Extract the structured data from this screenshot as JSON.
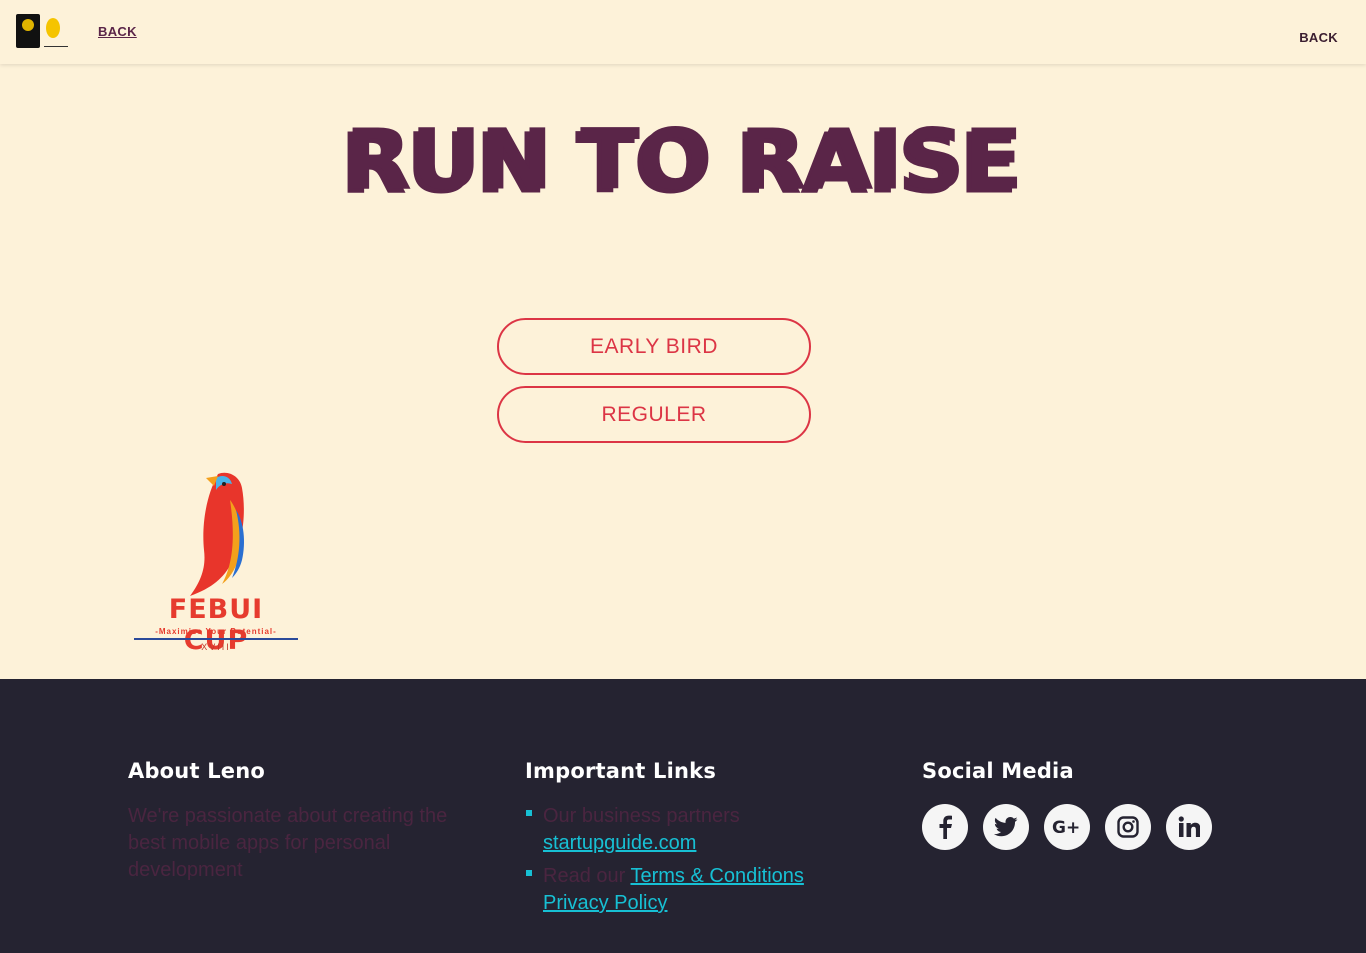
{
  "header": {
    "back_left_label": "BACK",
    "back_right_label": "BACK"
  },
  "main": {
    "title": "RUN TO RAISE",
    "buttons": [
      {
        "label": "EARLY BIRD"
      },
      {
        "label": "REGULER"
      }
    ],
    "event_logo": {
      "name": "FEBUI CUP",
      "tagline": "-Maximize Your Potential-",
      "edition": "XVIII"
    }
  },
  "footer": {
    "about": {
      "heading": "About Leno",
      "text": "We're passionate about creating the best mobile apps for personal development"
    },
    "links": {
      "heading": "Important Links",
      "item1_prefix": "Our business partners",
      "item1_link": "startupguide.com",
      "item2_prefix": "Read our",
      "item2_link1": "Terms & Conditions",
      "item2_link2": "Privacy Policy"
    },
    "social": {
      "heading": "Social Media",
      "icons": [
        "facebook-icon",
        "twitter-icon",
        "google-plus-icon",
        "instagram-icon",
        "linkedin-icon"
      ]
    }
  },
  "colors": {
    "background": "#fdf2d9",
    "title": "#5a2548",
    "button_accent": "#dc3545",
    "footer_bg": "#252331",
    "link": "#17c0d4"
  }
}
